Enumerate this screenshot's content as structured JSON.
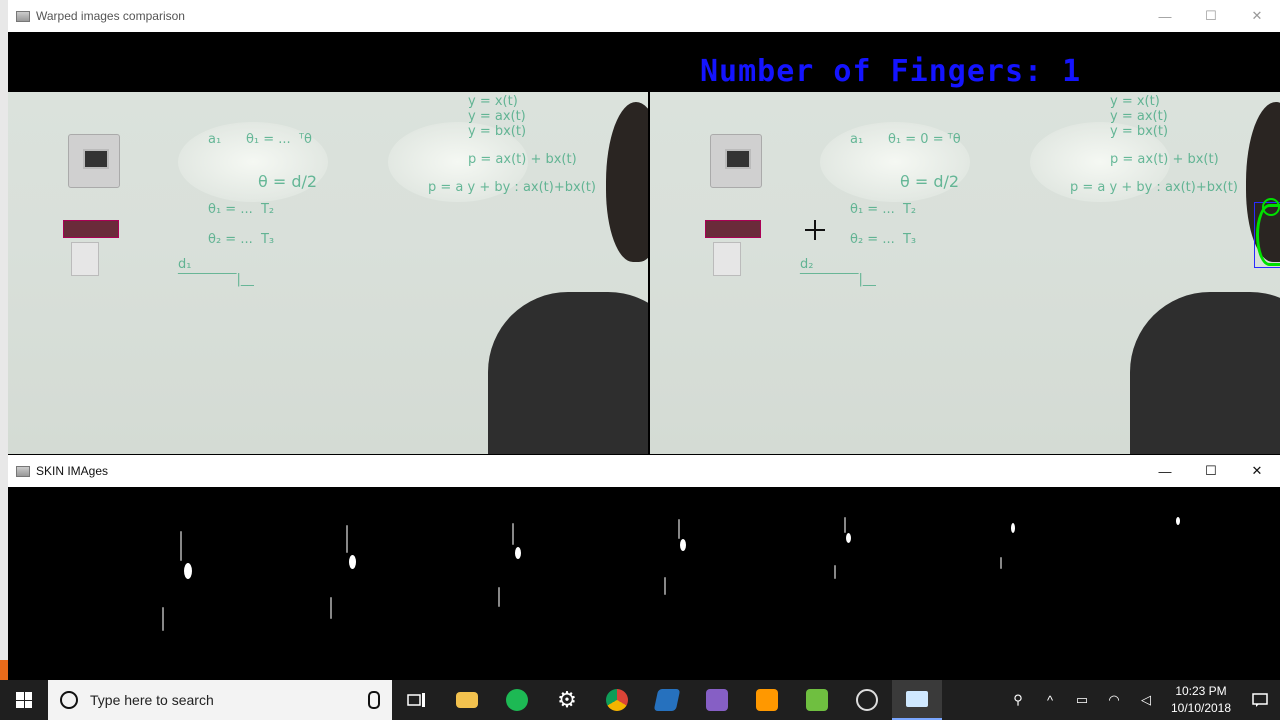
{
  "warped_window": {
    "title": "Warped images comparison",
    "overlay_text": "Number of Fingers: 1",
    "overlay_color": "#1414ff"
  },
  "skin_window": {
    "title": "SKIN IMAges"
  },
  "window_controls": {
    "minimize": "—",
    "maximize": "☐",
    "close": "✕"
  },
  "taskbar": {
    "search_placeholder": "Type here to search",
    "apps": [
      {
        "name": "task-view-icon"
      },
      {
        "name": "file-explorer-icon",
        "color": "#f2c14e"
      },
      {
        "name": "spotify-icon",
        "color": "#1db954"
      },
      {
        "name": "settings-gear-icon",
        "color": "#ffffff"
      },
      {
        "name": "chrome-icon",
        "color": "#4285f4"
      },
      {
        "name": "powershell-icon",
        "color": "#2671be"
      },
      {
        "name": "visual-studio-icon",
        "color": "#865fc5"
      },
      {
        "name": "sublime-text-icon",
        "color": "#ff9800"
      },
      {
        "name": "image-editor-icon",
        "color": "#6fbf40"
      },
      {
        "name": "obs-icon",
        "color": "#dddddd"
      },
      {
        "name": "python-window-icon",
        "color": "#cfe8ff"
      }
    ],
    "time": "10:23 PM",
    "date": "10/10/2018"
  }
}
